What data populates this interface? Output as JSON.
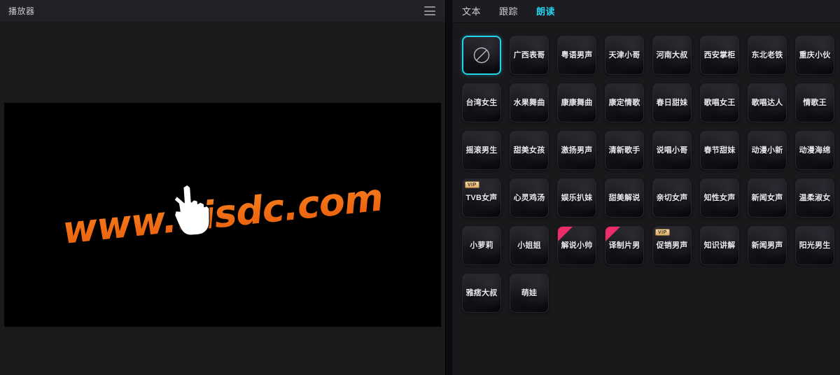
{
  "player": {
    "title": "播放器",
    "menu_icon": "hamburger-icon",
    "watermark": "www.uisdc.com",
    "cursor_icon": "pointing-hand-cursor",
    "accent_color": "#22d3ee",
    "watermark_color": "#f3731a"
  },
  "panel": {
    "tabs": [
      {
        "label": "文本",
        "active": false
      },
      {
        "label": "跟踪",
        "active": false
      },
      {
        "label": "朗读",
        "active": true
      }
    ],
    "voices": [
      {
        "label": "",
        "icon": "no-voice-icon",
        "selected": true,
        "vip": false,
        "ribbon": false
      },
      {
        "label": "广西表哥",
        "selected": false,
        "vip": false,
        "ribbon": false
      },
      {
        "label": "粤语男声",
        "selected": false,
        "vip": false,
        "ribbon": false
      },
      {
        "label": "天津小哥",
        "selected": false,
        "vip": false,
        "ribbon": false
      },
      {
        "label": "河南大叔",
        "selected": false,
        "vip": false,
        "ribbon": false
      },
      {
        "label": "西安掌柜",
        "selected": false,
        "vip": false,
        "ribbon": false
      },
      {
        "label": "东北老铁",
        "selected": false,
        "vip": false,
        "ribbon": false
      },
      {
        "label": "重庆小伙",
        "selected": false,
        "vip": false,
        "ribbon": false
      },
      {
        "label": "台湾女生",
        "selected": false,
        "vip": false,
        "ribbon": false
      },
      {
        "label": "水果舞曲",
        "selected": false,
        "vip": false,
        "ribbon": false
      },
      {
        "label": "康康舞曲",
        "selected": false,
        "vip": false,
        "ribbon": false
      },
      {
        "label": "康定情歌",
        "selected": false,
        "vip": false,
        "ribbon": false
      },
      {
        "label": "春日甜妹",
        "selected": false,
        "vip": false,
        "ribbon": false
      },
      {
        "label": "歌唱女王",
        "selected": false,
        "vip": false,
        "ribbon": false
      },
      {
        "label": "歌唱达人",
        "selected": false,
        "vip": false,
        "ribbon": false
      },
      {
        "label": "情歌王",
        "selected": false,
        "vip": false,
        "ribbon": false
      },
      {
        "label": "摇滚男生",
        "selected": false,
        "vip": false,
        "ribbon": false
      },
      {
        "label": "甜美女孩",
        "selected": false,
        "vip": false,
        "ribbon": false
      },
      {
        "label": "激扬男声",
        "selected": false,
        "vip": false,
        "ribbon": false
      },
      {
        "label": "清新歌手",
        "selected": false,
        "vip": false,
        "ribbon": false
      },
      {
        "label": "说唱小哥",
        "selected": false,
        "vip": false,
        "ribbon": false
      },
      {
        "label": "春节甜妹",
        "selected": false,
        "vip": false,
        "ribbon": false
      },
      {
        "label": "动漫小新",
        "selected": false,
        "vip": false,
        "ribbon": false
      },
      {
        "label": "动漫海绵",
        "selected": false,
        "vip": false,
        "ribbon": false
      },
      {
        "label": "TVB女声",
        "selected": false,
        "vip": true,
        "ribbon": false
      },
      {
        "label": "心灵鸡汤",
        "selected": false,
        "vip": false,
        "ribbon": false
      },
      {
        "label": "娱乐扒妹",
        "selected": false,
        "vip": false,
        "ribbon": false
      },
      {
        "label": "甜美解说",
        "selected": false,
        "vip": false,
        "ribbon": false
      },
      {
        "label": "亲切女声",
        "selected": false,
        "vip": false,
        "ribbon": false
      },
      {
        "label": "知性女声",
        "selected": false,
        "vip": false,
        "ribbon": false
      },
      {
        "label": "新闻女声",
        "selected": false,
        "vip": false,
        "ribbon": false
      },
      {
        "label": "温柔淑女",
        "selected": false,
        "vip": false,
        "ribbon": false
      },
      {
        "label": "小萝莉",
        "selected": false,
        "vip": false,
        "ribbon": false
      },
      {
        "label": "小姐姐",
        "selected": false,
        "vip": false,
        "ribbon": false
      },
      {
        "label": "解说小帅",
        "selected": false,
        "vip": false,
        "ribbon": true
      },
      {
        "label": "译制片男",
        "selected": false,
        "vip": false,
        "ribbon": true
      },
      {
        "label": "促销男声",
        "selected": false,
        "vip": true,
        "ribbon": false
      },
      {
        "label": "知识讲解",
        "selected": false,
        "vip": false,
        "ribbon": false
      },
      {
        "label": "新闻男声",
        "selected": false,
        "vip": false,
        "ribbon": false
      },
      {
        "label": "阳光男生",
        "selected": false,
        "vip": false,
        "ribbon": false
      },
      {
        "label": "雅痞大叔",
        "selected": false,
        "vip": false,
        "ribbon": false
      },
      {
        "label": "萌娃",
        "selected": false,
        "vip": false,
        "ribbon": false
      }
    ],
    "vip_badge_text": "VIP"
  }
}
